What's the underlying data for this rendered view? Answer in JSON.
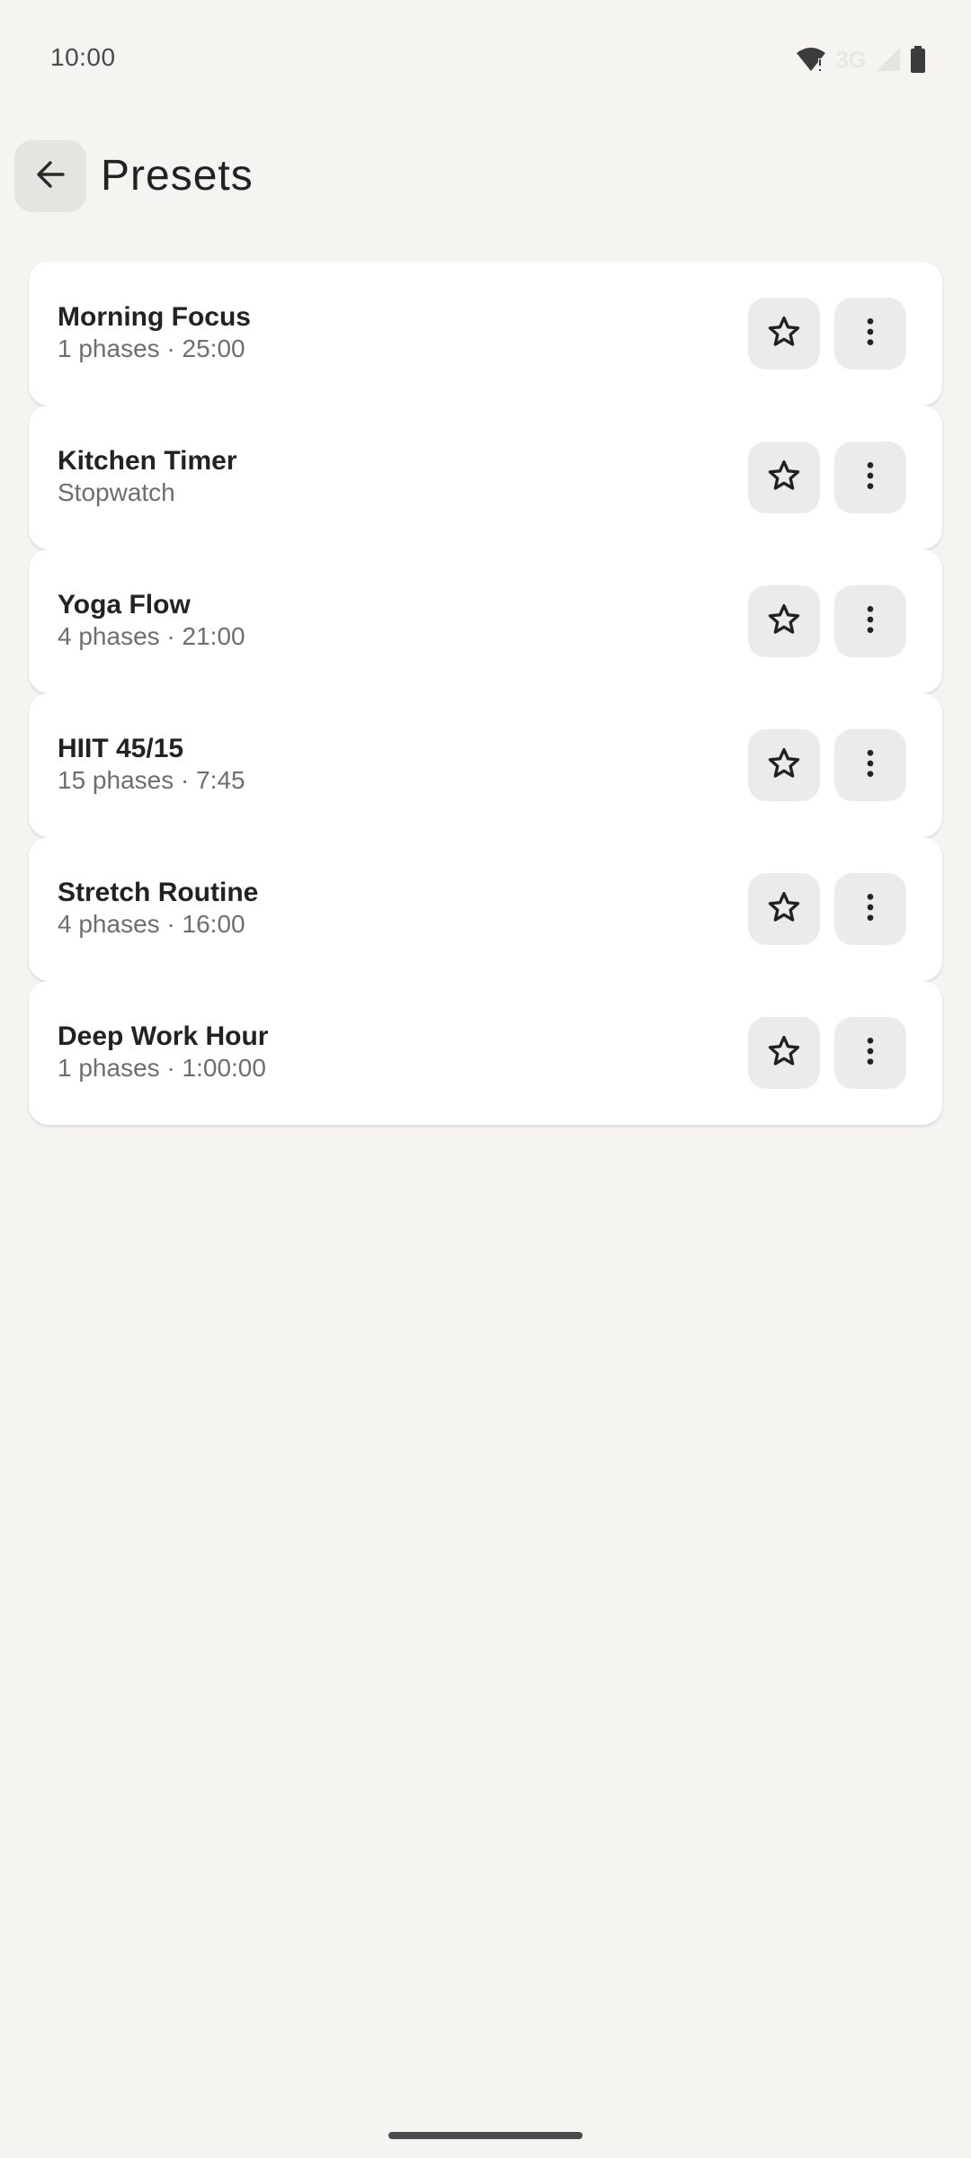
{
  "status_bar": {
    "time": "10:00",
    "network": "3G",
    "icons": [
      "wifi-alert-icon",
      "cell-signal-icon",
      "battery-icon"
    ]
  },
  "header": {
    "back_icon": "arrow-back-icon",
    "title": "Presets"
  },
  "presets": [
    {
      "name": "Morning Focus",
      "detail": "1 phases · 25:00"
    },
    {
      "name": "Kitchen Timer",
      "detail": "Stopwatch"
    },
    {
      "name": "Yoga Flow",
      "detail": "4 phases · 21:00"
    },
    {
      "name": "HIIT 45/15",
      "detail": "15 phases · 7:45"
    },
    {
      "name": "Stretch Routine",
      "detail": "4 phases · 16:00"
    },
    {
      "name": "Deep Work Hour",
      "detail": "1 phases · 1:00:00"
    }
  ],
  "item_actions": {
    "favorite_icon": "star-outline-icon",
    "more_icon": "more-vert-icon"
  },
  "colors": {
    "background": "#f5f4f1",
    "card": "#ffffff",
    "button": "#ebebea"
  }
}
